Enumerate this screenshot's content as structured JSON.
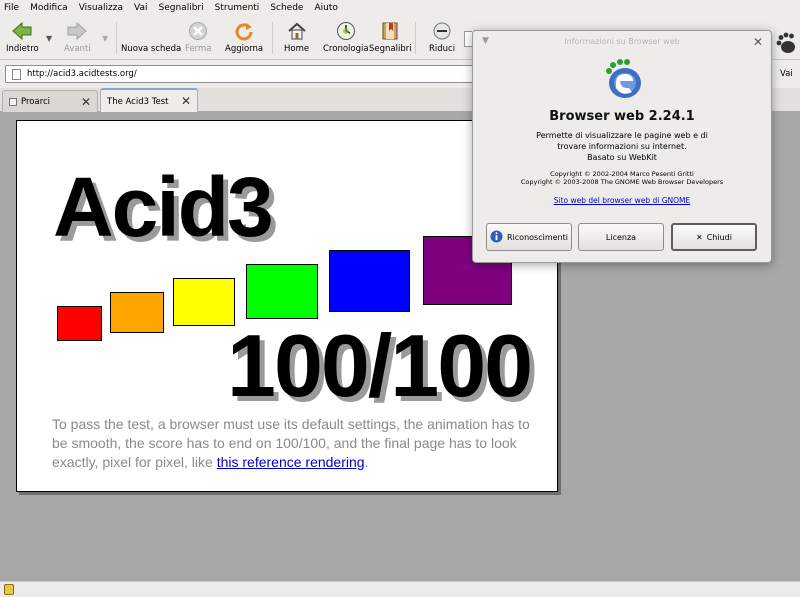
{
  "menubar": [
    "File",
    "Modifica",
    "Visualizza",
    "Vai",
    "Segnalibri",
    "Strumenti",
    "Schede",
    "Aiuto"
  ],
  "toolbar": {
    "back": "Indietro",
    "forward": "Avanti",
    "new_tab": "Nuova scheda",
    "stop": "Ferma",
    "reload": "Aggiorna",
    "home": "Home",
    "history": "Cronologia",
    "bookmarks": "Segnalibri",
    "zoom_out": "Riduci"
  },
  "address": {
    "url": "http://acid3.acidtests.org/",
    "go": "Vai"
  },
  "tabs": [
    {
      "label": "Proarci",
      "active": false
    },
    {
      "label": "The Acid3 Test",
      "active": true
    }
  ],
  "page": {
    "title": "Acid3",
    "score": "100/100",
    "text_before_link": "To pass the test, a browser must use its default settings, the animation has to be smooth, the score has to end on 100/100, and the final page has to look exactly, pixel for pixel, like ",
    "link_text": "this reference rendering",
    "text_after_link": "."
  },
  "colors": {
    "squares": [
      "#ff0000",
      "#ffa500",
      "#ffff00",
      "#00ff00",
      "#0000ff",
      "#800080"
    ],
    "link": "#0000cc"
  },
  "dialog": {
    "title": "Informazioni su Browser web",
    "app_name": "Browser web 2.24.1",
    "description_lines": [
      "Permette di visualizzare le pagine web e di",
      "trovare informazioni su internet.",
      "Basato su WebKit"
    ],
    "copyright_lines": [
      "Copyright © 2002-2004 Marco Pesenti Gritti",
      "Copyright © 2003-2008 The GNOME Web Browser Developers"
    ],
    "website_link": "Sito web del browser web di GNOME",
    "buttons": {
      "credits": "Riconoscimenti",
      "license": "Licenza",
      "close": "Chiudi"
    }
  }
}
